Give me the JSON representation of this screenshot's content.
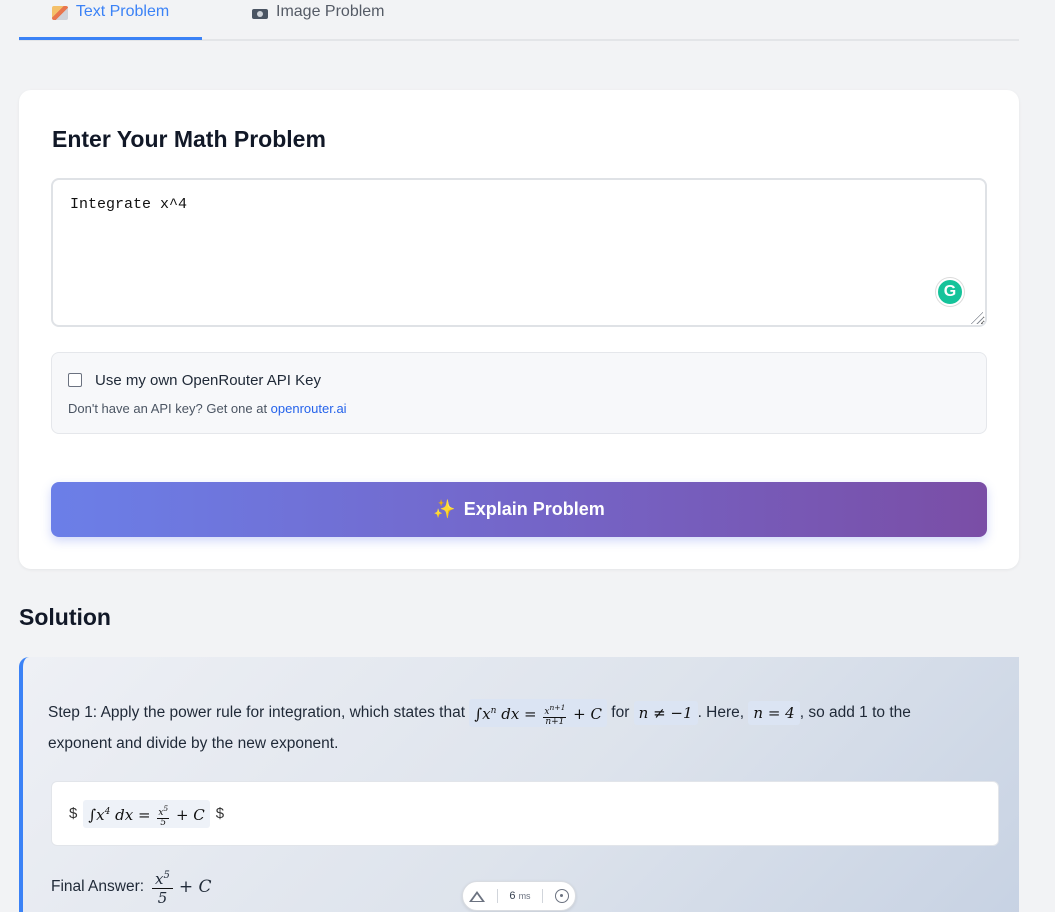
{
  "tabs": [
    {
      "label": "Text Problem",
      "icon": "pencil-icon",
      "active": true
    },
    {
      "label": "Image Problem",
      "icon": "camera-icon",
      "active": false
    }
  ],
  "card": {
    "title": "Enter Your Math Problem",
    "textarea_value": "Integrate x^4",
    "api_key_label": "Use my own OpenRouter API Key",
    "api_note_prefix": "Don't have an API key? Get one at ",
    "api_link": "openrouter.ai",
    "explain_button": "Explain Problem"
  },
  "solution": {
    "title": "Solution",
    "step1_part1": "Step 1: Apply the power rule for integration, which states that",
    "step1_for": "for",
    "step1_part2": ". Here,",
    "step1_part3": ", so add 1 to the exponent and divide by the new exponent.",
    "cond": "n ≠ −1",
    "n_value": "n = 4",
    "dollar_open": "$",
    "dollar_close": "$",
    "final_label": "Final Answer:"
  },
  "floater": {
    "ms_value": "6",
    "ms_unit": "ms"
  },
  "colors": {
    "accent": "#3b82f6",
    "button_start": "#6b7fe8",
    "button_end": "#7a4ea6"
  }
}
